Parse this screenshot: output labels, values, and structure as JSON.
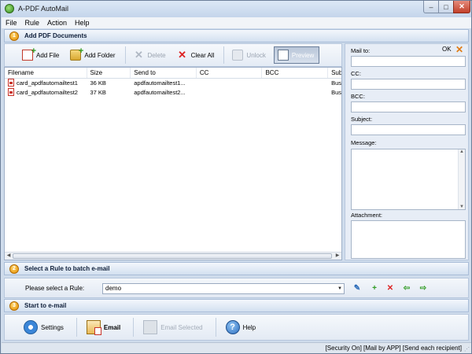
{
  "window": {
    "title": "A-PDF AutoMail",
    "min_glyph": "–",
    "max_glyph": "□",
    "close_glyph": "✕"
  },
  "menu": [
    "File",
    "Rule",
    "Action",
    "Help"
  ],
  "section1": {
    "step": "1",
    "title": "Add PDF Documents"
  },
  "toolbar": {
    "add_file": "Add File",
    "add_folder": "Add Folder",
    "delete": "Delete",
    "clear_all": "Clear All",
    "unlock": "Unlock",
    "preview": "Preview"
  },
  "file_list": {
    "columns": [
      "Filename",
      "Size",
      "Send to",
      "CC",
      "BCC",
      "Subj"
    ],
    "rows": [
      {
        "filename": "card_apdfautomailtest1",
        "size": "36 KB",
        "send_to": "apdfautomailtest1...",
        "cc": "",
        "bcc": "",
        "subject": "Busi"
      },
      {
        "filename": "card_apdfautomailtest2",
        "size": "37 KB",
        "send_to": "apdfautomailtest2...",
        "cc": "",
        "bcc": "",
        "subject": "Busi"
      }
    ]
  },
  "mail_panel": {
    "ok_label": "OK",
    "mail_to_label": "Mail to:",
    "cc_label": "CC:",
    "bcc_label": "BCC:",
    "subject_label": "Subject:",
    "message_label": "Message:",
    "attachment_label": "Attachment:"
  },
  "section2": {
    "step": "2",
    "title": "Select a Rule to batch e-mail"
  },
  "rule": {
    "label": "Please select a Rule:",
    "selected": "demo"
  },
  "section3": {
    "step": "3",
    "title": "Start to e-mail"
  },
  "actions": {
    "settings": "Settings",
    "email": "Email",
    "email_selected": "Email Selected",
    "help": "Help"
  },
  "status": "[Security On] [Mail by APP] [Send each recipient]"
}
